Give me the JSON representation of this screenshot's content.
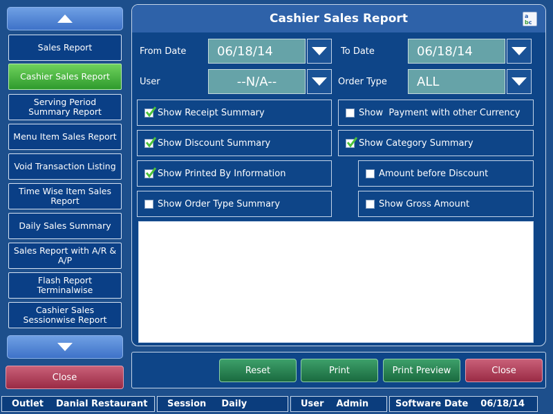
{
  "sidebar": {
    "items": [
      {
        "label": "Sales Report"
      },
      {
        "label": "Cashier Sales Report",
        "active": true
      },
      {
        "label": "Serving Period Summary Report"
      },
      {
        "label": "Menu Item Sales Report"
      },
      {
        "label": "Void Transaction Listing"
      },
      {
        "label": "Time Wise Item Sales Report"
      },
      {
        "label": "Daily Sales Summary"
      },
      {
        "label": "Sales Report with A/R & A/P"
      },
      {
        "label": "Flash Report Terminalwise"
      },
      {
        "label": "Cashier Sales Sessionwise Report"
      }
    ],
    "close_label": "Close"
  },
  "panel": {
    "title": "Cashier Sales Report",
    "from_date_label": "From Date",
    "from_date_value": "06/18/14",
    "to_date_label": "To Date",
    "to_date_value": "06/18/14",
    "user_label": "User",
    "user_value": "--N/A--",
    "order_type_label": "Order Type",
    "order_type_value": "ALL",
    "options": [
      {
        "label": "Show Receipt Summary",
        "checked": true
      },
      {
        "label": "Show  Payment with other Currency",
        "checked": false
      },
      {
        "label": "Show Discount Summary",
        "checked": true
      },
      {
        "label": "Show Category Summary",
        "checked": true
      },
      {
        "label": "Show Printed By Information",
        "checked": true
      },
      {
        "label": "Amount before Discount",
        "checked": false
      },
      {
        "label": "Show Order Type Summary",
        "checked": false
      },
      {
        "label": "Show Gross Amount",
        "checked": false
      }
    ]
  },
  "actions": {
    "reset": "Reset",
    "print": "Print",
    "print_preview": "Print Preview",
    "close": "Close"
  },
  "status": {
    "outlet_label": "Outlet",
    "outlet_value": "Danial Restaurant",
    "session_label": "Session",
    "session_value": "Daily",
    "user_label": "User",
    "user_value": "Admin",
    "software_date_label": "Software Date",
    "software_date_value": "06/18/14"
  },
  "colors": {
    "background": "#1d4f8c",
    "active_item": "#3aa836",
    "close_button": "#a83a55",
    "action_button": "#1f7a4a"
  }
}
